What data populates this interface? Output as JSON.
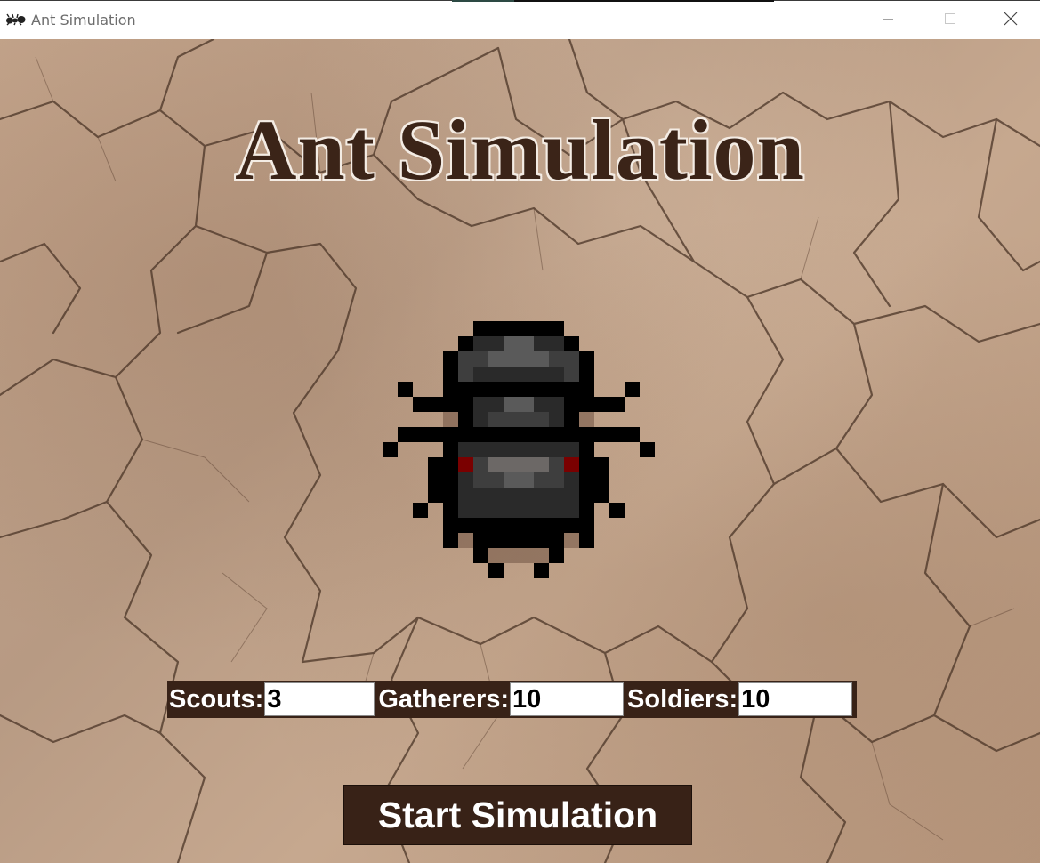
{
  "window": {
    "title": "Ant Simulation",
    "icon": "ant-icon",
    "controls": [
      "minimize-icon",
      "maximize-icon",
      "close-icon"
    ]
  },
  "main": {
    "title": "Ant Simulation",
    "sprite": "ant-icon",
    "background": "cracked-dry-earth"
  },
  "fields": {
    "scouts": {
      "label": "Scouts:",
      "value": "3"
    },
    "gatherers": {
      "label": "Gatherers:",
      "value": "10"
    },
    "soldiers": {
      "label": "Soldiers:",
      "value": "10"
    }
  },
  "start_button": {
    "label": "Start Simulation"
  },
  "colors": {
    "panel": "#382217",
    "title_text": "#3b2418",
    "title_outline": "#f4ece4",
    "ground": "#c4a58c",
    "accent_red": "#8b0000"
  }
}
